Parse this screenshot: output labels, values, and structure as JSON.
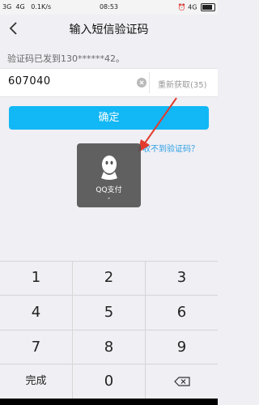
{
  "status_bar": {
    "left": "3G  4G   0.1K/s",
    "time": "08:53",
    "right": "4G"
  },
  "header": {
    "title": "输入短信验证码"
  },
  "form": {
    "hint": "验证码已发到130******42。",
    "code_value": "607040",
    "resend_label": "重新获取(35)",
    "confirm_label": "确定",
    "help_link": "收不到验证码？"
  },
  "toast": {
    "label": "QQ支付",
    "sub": "-"
  },
  "keypad": {
    "keys": [
      "1",
      "2",
      "3",
      "4",
      "5",
      "6",
      "7",
      "8",
      "9",
      "完成",
      "0",
      "backspace"
    ]
  },
  "colors": {
    "accent": "#12b7f5",
    "link": "#2d9fe6",
    "arrow": "#e23b2e"
  }
}
